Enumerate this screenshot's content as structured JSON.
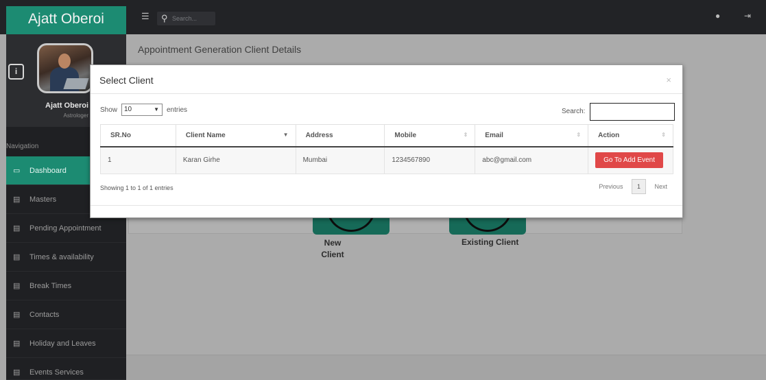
{
  "brand": "Ajatt Oberoi",
  "search": {
    "placeholder": "Search..."
  },
  "user": {
    "name": "Ajatt Oberoi",
    "role": "Astrologer"
  },
  "nav": {
    "heading": "Navigation",
    "items": [
      {
        "label": "Dashboard",
        "icon": "monitor-icon",
        "active": true
      },
      {
        "label": "Masters",
        "icon": "document-icon"
      },
      {
        "label": "Pending Appointment",
        "icon": "document-icon"
      },
      {
        "label": "Times & availability",
        "icon": "document-icon"
      },
      {
        "label": "Break Times",
        "icon": "document-icon"
      },
      {
        "label": "Contacts",
        "icon": "document-icon"
      },
      {
        "label": "Holiday and Leaves",
        "icon": "document-icon"
      },
      {
        "label": "Events Services",
        "icon": "document-icon"
      }
    ]
  },
  "page": {
    "title": "Appointment Generation Client Details",
    "new_client_label": "New\nClient",
    "existing_client_label": "Existing Client"
  },
  "modal": {
    "title": "Select Client",
    "close": "×",
    "length_label": "Show",
    "length_value": "10",
    "length_suffix": "entries",
    "search_label": "Search:",
    "search_value": "",
    "columns": [
      "SR.No",
      "Client Name",
      "Address",
      "Mobile",
      "Email",
      "Action"
    ],
    "rows": [
      {
        "sr": "1",
        "name": "Karan Girhe",
        "address": "Mumbai",
        "mobile": "1234567890",
        "email": "abc@gmail.com",
        "action": "Go To Add Event"
      }
    ],
    "info": "Showing 1 to 1 of 1 entries",
    "pager": {
      "previous": "Previous",
      "page": "1",
      "next": "Next"
    }
  },
  "colors": {
    "accent": "#1c8b72",
    "danger": "#e04848",
    "topbar": "#222326"
  }
}
